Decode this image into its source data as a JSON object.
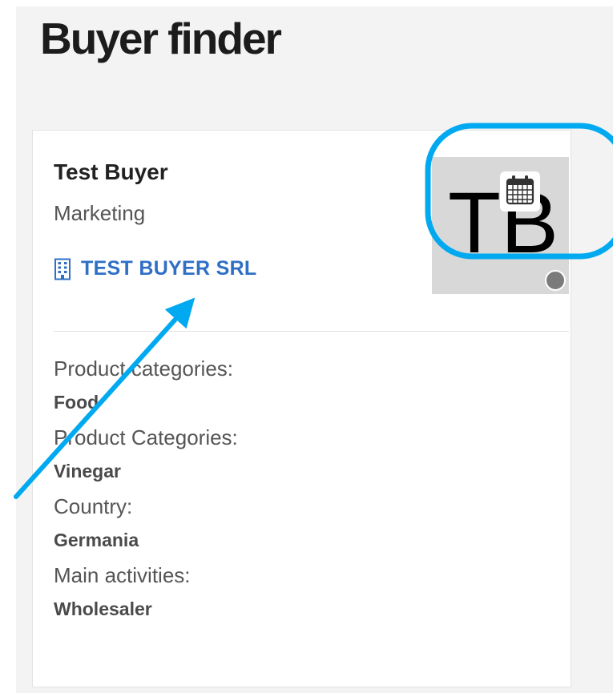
{
  "page": {
    "title": "Buyer finder"
  },
  "buyer": {
    "name": "Test Buyer",
    "role": "Marketing",
    "company": "TEST BUYER SRL",
    "company_icon": "building-icon",
    "avatar_initials": "TB",
    "calendar_icon": "calendar-icon",
    "status": "offline"
  },
  "details": [
    {
      "label": "Product categories:",
      "value": "Food"
    },
    {
      "label": "Product Categories:",
      "value": "Vinegar"
    },
    {
      "label": "Country:",
      "value": "Germania"
    },
    {
      "label": "Main activities:",
      "value": "Wholesaler"
    }
  ],
  "colors": {
    "link": "#2f6fc4",
    "annotation": "#00a9f0",
    "status_dot": "#7b7b7b",
    "avatar_bg": "#d8d8d8"
  }
}
